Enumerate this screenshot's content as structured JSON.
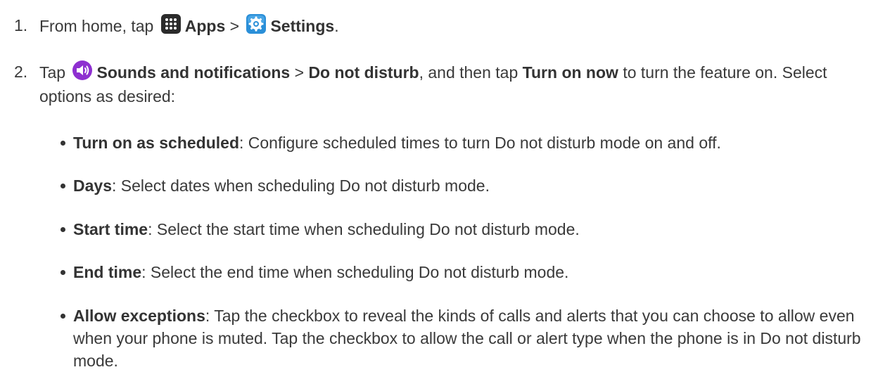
{
  "steps": [
    {
      "number": "1.",
      "t1": "From home, tap",
      "apps": "Apps",
      "sep": ">",
      "settings": "Settings",
      "end": "."
    },
    {
      "number": "2.",
      "t1": "Tap",
      "sounds": "Sounds and notifications",
      "sep": ">",
      "dnd": "Do not disturb",
      "t2": ", and then tap",
      "turn_on_now": "Turn on now",
      "t3": "to turn the feature on. Select options as desired:"
    }
  ],
  "options": [
    {
      "label": "Turn on as scheduled",
      "desc": ": Configure scheduled times to turn Do not disturb mode on and off."
    },
    {
      "label": "Days",
      "desc": ": Select dates when scheduling Do not disturb mode."
    },
    {
      "label": "Start time",
      "desc": ": Select the start time when scheduling Do not disturb mode."
    },
    {
      "label": "End time",
      "desc": ": Select the end time when scheduling Do not disturb mode."
    },
    {
      "label": "Allow exceptions",
      "desc": ": Tap the checkbox to reveal the kinds of calls and alerts that you can choose to allow even when your phone is muted. Tap the checkbox to allow the call or alert type when the phone is in Do not disturb mode."
    }
  ],
  "icons": {
    "apps": "apps-grid-icon",
    "settings": "settings-gear-icon",
    "sounds": "sound-speaker-icon"
  },
  "colors": {
    "apps_icon": "#2b2b2b",
    "settings_icon": "#2a8fd8",
    "sounds_icon": "#8e2fd0",
    "text": "#3a3a3a"
  }
}
